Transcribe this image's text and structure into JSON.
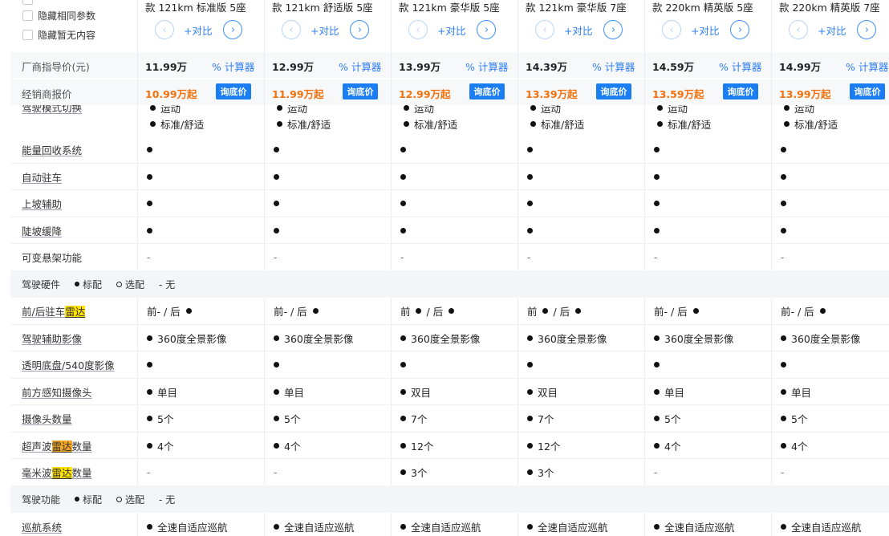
{
  "filters": {
    "hide_same": "隐藏相同参数",
    "hide_empty": "隐藏暂无内容"
  },
  "columns": [
    {
      "title": "款 121km 标准版 5座",
      "compare": "+对比",
      "msrp": "11.99万",
      "calc": "计算器",
      "dealer": "10.99万起",
      "ask": "询底价"
    },
    {
      "title": "款 121km 舒适版 5座",
      "compare": "+对比",
      "msrp": "12.99万",
      "calc": "计算器",
      "dealer": "11.99万起",
      "ask": "询底价"
    },
    {
      "title": "款 121km 豪华版 5座",
      "compare": "+对比",
      "msrp": "13.99万",
      "calc": "计算器",
      "dealer": "12.99万起",
      "ask": "询底价"
    },
    {
      "title": "款 121km 豪华版 7座",
      "compare": "+对比",
      "msrp": "14.39万",
      "calc": "计算器",
      "dealer": "13.39万起",
      "ask": "询底价"
    },
    {
      "title": "款 220km 精英版 5座",
      "compare": "+对比",
      "msrp": "14.59万",
      "calc": "计算器",
      "dealer": "13.59万起",
      "ask": "询底价"
    },
    {
      "title": "款 220km 精英版 7座",
      "compare": "+对比",
      "msrp": "14.99万",
      "calc": "计算器",
      "dealer": "13.99万起",
      "ask": "询底价"
    }
  ],
  "price_labels": {
    "msrp": "厂商指导价(元)",
    "dealer": "经销商报价"
  },
  "drive_mode_partial": {
    "label": "驾驶模式切换",
    "line1": "运动",
    "line2": "标准/舒适"
  },
  "rows_a": [
    {
      "label": "能量回收系统",
      "values": [
        "●",
        "●",
        "●",
        "●",
        "●",
        "●"
      ]
    },
    {
      "label": "自动驻车",
      "values": [
        "●",
        "●",
        "●",
        "●",
        "●",
        "●"
      ]
    },
    {
      "label": "上坡辅助",
      "values": [
        "●",
        "●",
        "●",
        "●",
        "●",
        "●"
      ]
    },
    {
      "label": "陡坡缓降",
      "values": [
        "●",
        "●",
        "●",
        "●",
        "●",
        "●"
      ]
    },
    {
      "label": "可变悬架功能",
      "values": [
        "-",
        "-",
        "-",
        "-",
        "-",
        "-"
      ]
    }
  ],
  "section_hardware": {
    "title": "驾驶硬件",
    "legend_std": "标配",
    "legend_opt": "选配",
    "legend_none": "- 无"
  },
  "rows_b": [
    {
      "label_pre": "前/后驻车",
      "label_hl": "雷达",
      "label_post": "",
      "values": [
        "前- / 后 ●",
        "前- / 后 ●",
        "前 ● / 后 ●",
        "前 ● / 后 ●",
        "前- / 后 ●",
        "前- / 后 ●"
      ]
    },
    {
      "label_pre": "驾驶辅助影像",
      "label_hl": "",
      "label_post": "",
      "values": [
        "● 360度全景影像",
        "● 360度全景影像",
        "● 360度全景影像",
        "● 360度全景影像",
        "● 360度全景影像",
        "● 360度全景影像"
      ]
    },
    {
      "label_pre": "透明底盘/540度影像",
      "label_hl": "",
      "label_post": "",
      "values": [
        "●",
        "●",
        "●",
        "●",
        "●",
        "●"
      ]
    },
    {
      "label_pre": "前方感知摄像头",
      "label_hl": "",
      "label_post": "",
      "values": [
        "● 单目",
        "● 单目",
        "● 双目",
        "● 双目",
        "● 单目",
        "● 单目"
      ]
    },
    {
      "label_pre": "摄像头数量",
      "label_hl": "",
      "label_post": "",
      "values": [
        "● 5个",
        "● 5个",
        "● 7个",
        "● 7个",
        "● 5个",
        "● 5个"
      ]
    },
    {
      "label_pre": "超声波",
      "label_hl": "雷达",
      "label_post": "数量",
      "values": [
        "● 4个",
        "● 4个",
        "● 12个",
        "● 12个",
        "● 4个",
        "● 4个"
      ]
    },
    {
      "label_pre": "毫米波",
      "label_hl": "雷达",
      "label_post": "数量",
      "values": [
        "-",
        "-",
        "● 3个",
        "● 3个",
        "-",
        "-"
      ]
    }
  ],
  "section_function": {
    "title": "驾驶功能",
    "legend_std": "标配",
    "legend_opt": "选配",
    "legend_none": "- 无"
  },
  "rows_c": [
    {
      "label": "巡航系统",
      "values": [
        "● 全速自适应巡航",
        "● 全速自适应巡航",
        "● 全速自适应巡航",
        "● 全速自适应巡航",
        "● 全速自适应巡航",
        "● 全速自适应巡航"
      ]
    }
  ]
}
